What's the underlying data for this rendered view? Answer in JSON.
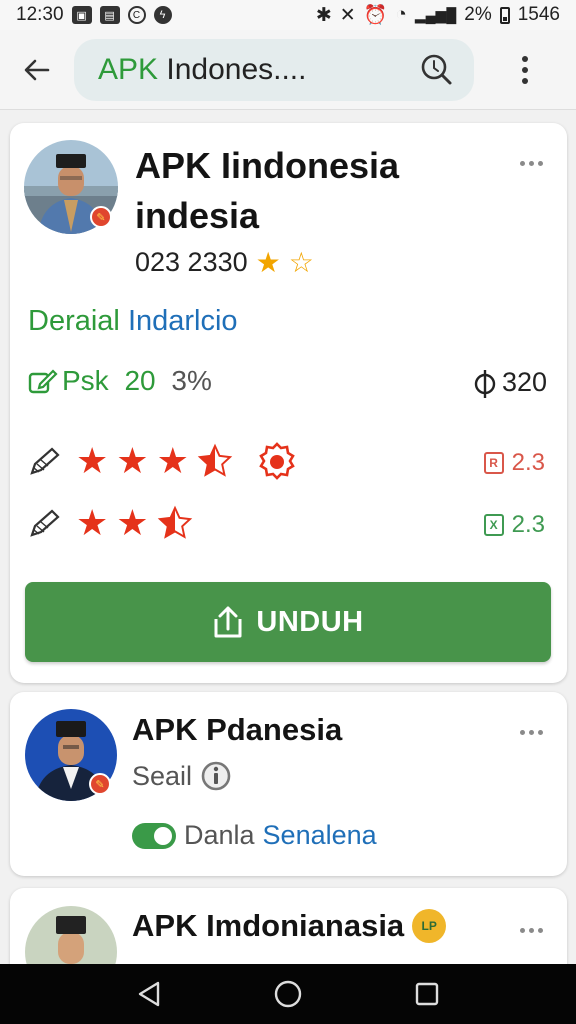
{
  "status_bar": {
    "time": "12:30",
    "battery": "2%",
    "clock": "1546"
  },
  "search": {
    "query_green": "APK",
    "query_rest": " Indones...."
  },
  "card1": {
    "title_line1": "APK Iindonesia",
    "title_line2": "indesia",
    "code": "023 2330",
    "detail_green": "Deraial",
    "detail_blue": "Indarlcio",
    "psk_label": "Psk",
    "psk_value": "20",
    "psk_percent": "3%",
    "count": "320",
    "rating1": {
      "stars": 3.5,
      "value": "2.3",
      "box_letter": "R"
    },
    "rating2": {
      "stars": 2.5,
      "value": "2.3",
      "box_letter": "X"
    },
    "download_label": "UNDUH"
  },
  "card2": {
    "title": "APK Pdanesia",
    "subtitle": "Seail",
    "toggle_label_gray": "Danla",
    "toggle_label_blue": "Senalena"
  },
  "card3": {
    "title": "APK Imdonianasia",
    "badge_text": "LP"
  },
  "colors": {
    "accent_green": "#48944a",
    "star_red": "#e5321a",
    "link_blue": "#1f6fb8"
  }
}
